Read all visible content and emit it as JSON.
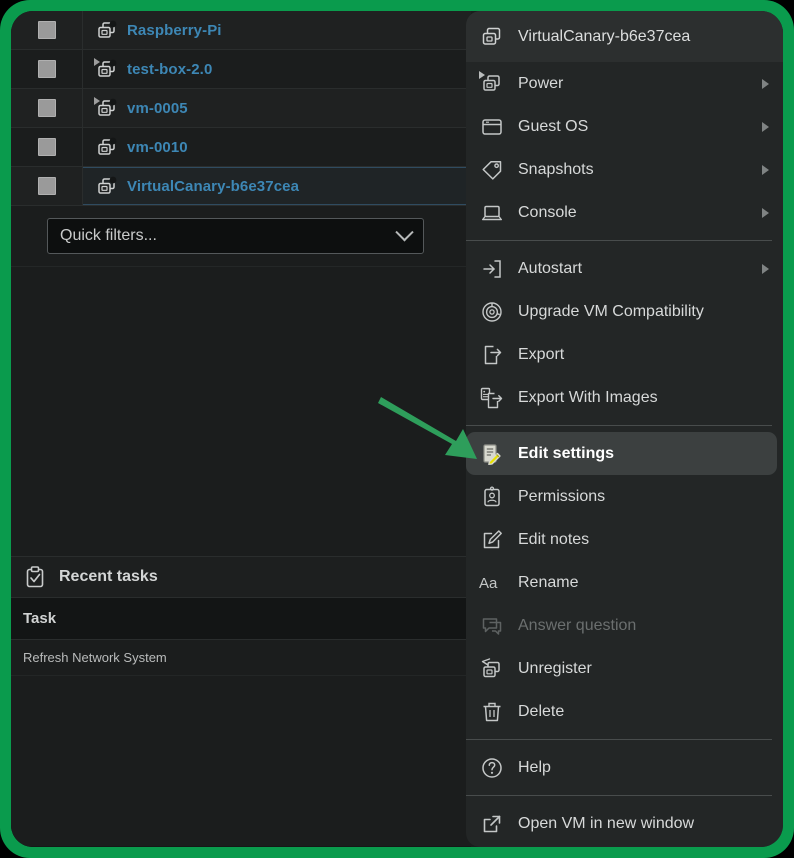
{
  "theme": {
    "frame_color": "#0a9b4d",
    "panel_bg": "#1b1d1d",
    "menu_bg": "#232626",
    "menu_header_bg": "#2c2f2f",
    "highlight_bg": "#3c4040",
    "vm_link_color": "#3d87b5",
    "arrow_color": "#2e9e5b"
  },
  "vm_list": {
    "rows": [
      {
        "name": "Raspberry-Pi",
        "icon": "vm-icon",
        "expandable": false,
        "selected": false,
        "checked": false
      },
      {
        "name": "test-box-2.0",
        "icon": "vm-icon",
        "expandable": true,
        "selected": false,
        "checked": false
      },
      {
        "name": "vm-0005",
        "icon": "vm-icon",
        "expandable": true,
        "selected": false,
        "checked": false
      },
      {
        "name": "vm-0010",
        "icon": "vm-icon",
        "expandable": false,
        "selected": false,
        "checked": false
      },
      {
        "name": "VirtualCanary-b6e37cea",
        "icon": "vm-icon",
        "expandable": false,
        "selected": true,
        "checked": false
      }
    ]
  },
  "quick_filters": {
    "placeholder": "Quick filters...",
    "value": "Quick filters...",
    "chevron": "chevron-down-icon"
  },
  "recent_tasks": {
    "icon": "clipboard-check-icon",
    "title": "Recent tasks",
    "columns": [
      "Task"
    ],
    "rows": [
      {
        "task": "Refresh Network System"
      }
    ]
  },
  "context_menu": {
    "header": {
      "icon": "vm-icon",
      "label": "VirtualCanary-b6e37cea"
    },
    "groups": [
      {
        "items": [
          {
            "label": "Power",
            "icon": "vm-power-icon",
            "submenu": true,
            "disabled": false,
            "highlighted": false,
            "expander": true
          },
          {
            "label": "Guest OS",
            "icon": "window-icon",
            "submenu": true,
            "disabled": false,
            "highlighted": false,
            "expander": false
          },
          {
            "label": "Snapshots",
            "icon": "tag-icon",
            "submenu": true,
            "disabled": false,
            "highlighted": false,
            "expander": false
          },
          {
            "label": "Console",
            "icon": "laptop-icon",
            "submenu": true,
            "disabled": false,
            "highlighted": false,
            "expander": false
          }
        ]
      },
      {
        "items": [
          {
            "label": "Autostart",
            "icon": "autostart-icon",
            "submenu": true,
            "disabled": false,
            "highlighted": false,
            "expander": false
          },
          {
            "label": "Upgrade VM Compatibility",
            "icon": "upgrade-icon",
            "submenu": false,
            "disabled": false,
            "highlighted": false,
            "expander": false
          },
          {
            "label": "Export",
            "icon": "export-icon",
            "submenu": false,
            "disabled": false,
            "highlighted": false,
            "expander": false
          },
          {
            "label": "Export With Images",
            "icon": "export-images-icon",
            "submenu": false,
            "disabled": false,
            "highlighted": false,
            "expander": false
          }
        ]
      },
      {
        "items": [
          {
            "label": "Edit settings",
            "icon": "edit-settings-icon",
            "submenu": false,
            "disabled": false,
            "highlighted": true,
            "expander": false
          },
          {
            "label": "Permissions",
            "icon": "badge-icon",
            "submenu": false,
            "disabled": false,
            "highlighted": false,
            "expander": false
          },
          {
            "label": "Edit notes",
            "icon": "pencil-square-icon",
            "submenu": false,
            "disabled": false,
            "highlighted": false,
            "expander": false
          },
          {
            "label": "Rename",
            "icon": "rename-aa-icon",
            "submenu": false,
            "disabled": false,
            "highlighted": false,
            "expander": false
          },
          {
            "label": "Answer question",
            "icon": "chat-icon",
            "submenu": false,
            "disabled": true,
            "highlighted": false,
            "expander": false
          },
          {
            "label": "Unregister",
            "icon": "unregister-icon",
            "submenu": false,
            "disabled": false,
            "highlighted": false,
            "expander": false
          },
          {
            "label": "Delete",
            "icon": "trash-icon",
            "submenu": false,
            "disabled": false,
            "highlighted": false,
            "expander": false
          }
        ]
      },
      {
        "items": [
          {
            "label": "Help",
            "icon": "help-circle-icon",
            "submenu": false,
            "disabled": false,
            "highlighted": false,
            "expander": false
          }
        ]
      },
      {
        "items": [
          {
            "label": "Open VM in new window",
            "icon": "external-link-icon",
            "submenu": false,
            "disabled": false,
            "highlighted": false,
            "expander": false
          }
        ]
      }
    ]
  },
  "annotation": {
    "arrow": "green-pointer-arrow",
    "points_to": "Edit settings"
  }
}
